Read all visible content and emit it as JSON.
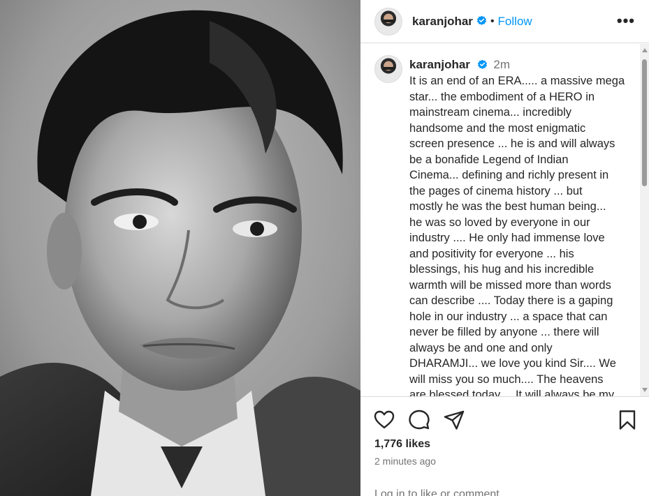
{
  "post": {
    "username": "karanjohar",
    "follow_label": "Follow",
    "separator": "•",
    "more_label": "•••",
    "time_ago": "2m",
    "caption_lines": [
      "It is an end of an ERA..... a massive mega",
      "star... the embodiment of a HERO in",
      "mainstream cinema... incredibly",
      "handsome and the most  enigmatic",
      "screen presence ... he is and will always",
      "be a bonafide Legend of Indian",
      "Cinema... defining and richly present in",
      "the pages of cinema history ... but",
      "mostly he was the best human being...",
      "he was so loved by everyone in our",
      "industry .... He only had immense love",
      "and positivity for everyone ... his",
      "blessings, his hug and his incredible",
      "warmth will be missed more than words",
      "can describe .... Today there is a gaping",
      "hole in our industry ... a space that can",
      "never be filled by anyone ... there will",
      "always be and one and only",
      "DHARAMJI... we love you kind Sir.... We",
      "will miss you so much.... The heavens",
      "are blessed today.... It will always be my"
    ],
    "likes": "1,776 likes",
    "posted_ago": "2 minutes ago",
    "login_prompt": "Log in to like or comment."
  },
  "icons": {
    "verified": "verified-badge-icon",
    "like": "heart-icon",
    "comment": "comment-icon",
    "share": "paper-plane-icon",
    "save": "bookmark-icon",
    "more": "more-options-icon"
  },
  "colors": {
    "accent": "#0095f6",
    "text": "#262626",
    "muted": "#737373",
    "divider": "#dbdbdb"
  }
}
